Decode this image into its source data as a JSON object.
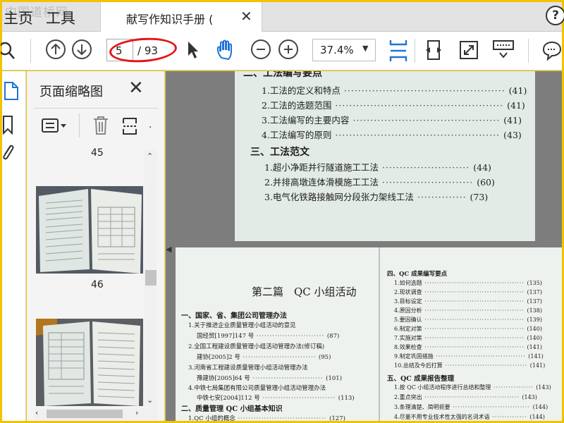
{
  "watermark": "中国道桥网",
  "tabs": {
    "home": "主页",
    "tools": "工具",
    "doc_title": "献写作知识手册 ("
  },
  "toolbar": {
    "page_current": "5",
    "page_total": "/ 93",
    "zoom": "37.4%"
  },
  "panel": {
    "title": "页面缩略图",
    "thumbnails": [
      {
        "label": "45"
      },
      {
        "label": "46"
      }
    ]
  },
  "page_a": {
    "heading_partial": "二、工法编写要点",
    "items": [
      {
        "text": "1.工法的定义和特点",
        "page": "(41)"
      },
      {
        "text": "2.工法的选题范围",
        "page": "(41)"
      },
      {
        "text": "3.工法编写的主要内容",
        "page": "(41)"
      },
      {
        "text": "4.工法编写的原则",
        "page": "(43)"
      }
    ],
    "section": "三、工法范文",
    "examples": [
      {
        "text": "1.超小净距并行隧道施工工法",
        "page": "(44)"
      },
      {
        "text": "2.并排高墩连体滑模施工工法",
        "page": "(60)"
      },
      {
        "text": "3.电气化铁路接触网分段张力架线工法",
        "page": "(73)"
      }
    ]
  },
  "page_b_left": {
    "chapter": "第二篇　QC 小组活动",
    "section1": "一、国家、省、集团公司管理办法",
    "entries": [
      {
        "text": "1.关于推进企业质量管理小组活动的意见",
        "page": ""
      },
      {
        "text": "国经贸[1997]147 号",
        "page": "(87)"
      },
      {
        "text": "2.全国工程建设质量管理小组活动管理办法(修订稿)",
        "page": ""
      },
      {
        "text": "建协[2005]2 号",
        "page": "(95)"
      },
      {
        "text": "3.河南省工程建设质量管理小组活动管理办法",
        "page": ""
      },
      {
        "text": "豫建协[2005]64 号",
        "page": "(101)"
      },
      {
        "text": "4.中铁七局集团有限公司质量管理小组活动管理办法",
        "page": ""
      },
      {
        "text": "中铁七安[2004]112 号",
        "page": "(113)"
      }
    ],
    "section2": "二、质量管理 QC 小组基本知识",
    "entry_last": {
      "text": "1.QC 小组的概念",
      "page": "(127)"
    }
  },
  "page_b_right": {
    "section4": "四、QC 成果编写要点",
    "items": [
      {
        "text": "1.如何选题",
        "page": "(135)"
      },
      {
        "text": "2.现状调查",
        "page": "(137)"
      },
      {
        "text": "3.目标设定",
        "page": "(137)"
      },
      {
        "text": "4.原因分析",
        "page": "(138)"
      },
      {
        "text": "5.要因确认",
        "page": "(139)"
      },
      {
        "text": "6.制定对策",
        "page": "(140)"
      },
      {
        "text": "7.实施对策",
        "page": "(140)"
      },
      {
        "text": "8.效果检查",
        "page": "(141)"
      },
      {
        "text": "9.制定巩固措施",
        "page": "(141)"
      },
      {
        "text": "10.总结及今后打算",
        "page": "(141)"
      }
    ],
    "section5": "五、QC 成果报告整理",
    "items2": [
      {
        "text": "1.按 QC 小组活动程序进行总结和整理",
        "page": "(143)"
      },
      {
        "text": "2.重点突出",
        "page": "(143)"
      },
      {
        "text": "3.条理清楚、简明扼要",
        "page": "(144)"
      },
      {
        "text": "4.尽量不用专业技术性太强的名词术语",
        "page": "(144)"
      }
    ]
  },
  "colors": {
    "frame": "#f1c300",
    "annotation": "#e3151a",
    "accent_blue": "#1f73d8"
  }
}
